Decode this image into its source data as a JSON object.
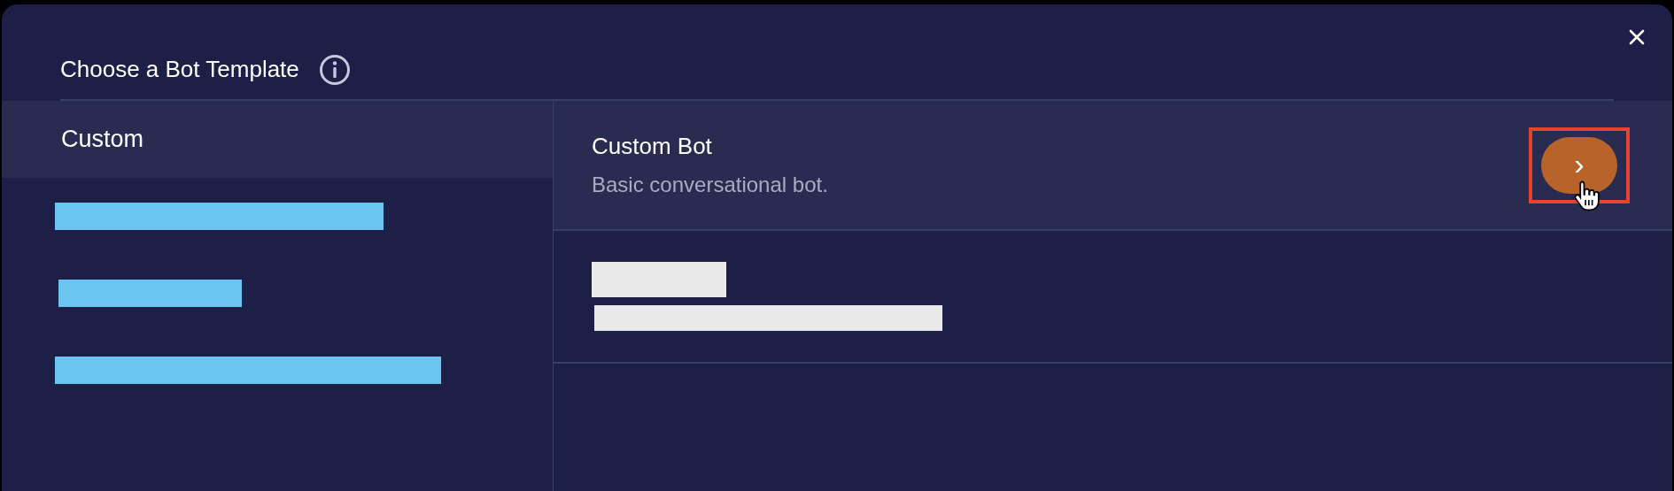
{
  "dialog": {
    "title": "Choose a Bot Template"
  },
  "categories": [
    {
      "kind": "text",
      "label": "Custom",
      "selected": true
    },
    {
      "kind": "redacted",
      "selected": false
    },
    {
      "kind": "redacted",
      "selected": false
    },
    {
      "kind": "redacted",
      "selected": false
    }
  ],
  "templates": [
    {
      "kind": "text",
      "name": "Custom Bot",
      "description": "Basic conversational bot.",
      "selected": true,
      "action": {
        "highlighted": true,
        "icon": "›"
      }
    },
    {
      "kind": "redacted",
      "selected": false
    }
  ]
}
